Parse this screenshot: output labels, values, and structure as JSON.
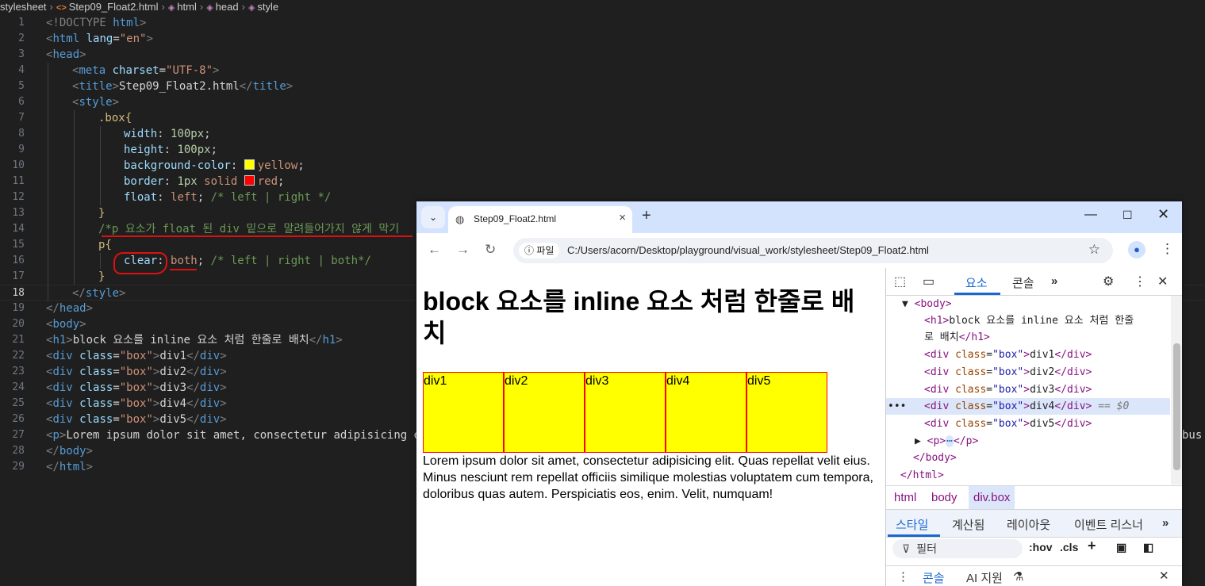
{
  "editor": {
    "breadcrumbs": [
      "stylesheet",
      "Step09_Float2.html",
      "html",
      "head",
      "style"
    ],
    "lines": [
      {
        "n": "1"
      },
      {
        "n": "2"
      },
      {
        "n": "3"
      },
      {
        "n": "4"
      },
      {
        "n": "5"
      },
      {
        "n": "6"
      },
      {
        "n": "7"
      },
      {
        "n": "8"
      },
      {
        "n": "9"
      },
      {
        "n": "10"
      },
      {
        "n": "11"
      },
      {
        "n": "12"
      },
      {
        "n": "13"
      },
      {
        "n": "14"
      },
      {
        "n": "15"
      },
      {
        "n": "16"
      },
      {
        "n": "17"
      },
      {
        "n": "18"
      },
      {
        "n": "19"
      },
      {
        "n": "20"
      },
      {
        "n": "21"
      },
      {
        "n": "22"
      },
      {
        "n": "23"
      },
      {
        "n": "24"
      },
      {
        "n": "25"
      },
      {
        "n": "26"
      },
      {
        "n": "27"
      },
      {
        "n": "28"
      },
      {
        "n": "29"
      }
    ],
    "tokens": {
      "doctype": "<!DOCTYPE",
      "html_kw": " html",
      "html": "html",
      "lang": " lang",
      "lang_val": "\"en\"",
      "head": "head",
      "meta": "meta",
      "charset": " charset",
      "charset_val": "\"UTF-8\"",
      "title": "title",
      "title_text": "Step09_Float2.html",
      "style": "style",
      "box_sel": ".box{",
      "width_prop": "width",
      "width_val": "100px",
      "height_prop": "height",
      "height_val": "100px",
      "bg_prop": "background-color",
      "bg_val": "yellow",
      "border_prop": "border",
      "border_num": "1px",
      "border_style": " solid ",
      "border_color": "red",
      "float_prop": "float",
      "float_val": "left",
      "float_comment": "/* left | right */",
      "close_brace": "}",
      "p_comment": "/*p 요소가 float 된 div 밑으로 말려들어가지 않게 막기",
      "p_sel": "p{",
      "clear_prop": "clear",
      "clear_val": "both",
      "clear_comment": "/* left | right | both*/",
      "body": "body",
      "h1": "h1",
      "h1_text": "block 요소를 inline 요소 처럼 한줄로 배치",
      "div": "div",
      "class": " class",
      "class_val": "\"box\"",
      "div1": "div1",
      "div2": "div2",
      "div3": "div3",
      "div4": "div4",
      "div5": "div5",
      "p": "p",
      "p_text": "Lorem ipsum dolor sit amet, consectetur adipisicing el",
      "p_tail": "bus"
    }
  },
  "browser": {
    "tab_title": "Step09_Float2.html",
    "info_chip": "파일",
    "url": "C:/Users/acorn/Desktop/playground/visual_work/stylesheet/Step09_Float2.html",
    "page": {
      "h1": "block 요소를 inline 요소 처럼 한줄로 배치",
      "boxes": [
        "div1",
        "div2",
        "div3",
        "div4",
        "div5"
      ],
      "paragraph": "Lorem ipsum dolor sit amet, consectetur adipisicing elit. Quas repellat velit eius. Minus nesciunt rem repellat officiis similique molestias voluptatem cum tempora, doloribus quas autem. Perspiciatis eos, enim. Velit, numquam!"
    }
  },
  "devtools": {
    "tabs": [
      "요소",
      "콘솔"
    ],
    "tree": {
      "body_open": "<body>",
      "h1_open": "<h1>",
      "h1_text_1": "block 요소를 inline 요소 처럼 한줄",
      "h1_text_2": "로 배치",
      "h1_close": "</h1>",
      "div_open": "<div",
      "class_attr": " class",
      "class_val": "\"box\"",
      "gt": ">",
      "div_close": "</div>",
      "div_texts": [
        "div1",
        "div2",
        "div3",
        "div4",
        "div5"
      ],
      "selected_marker": "== $0",
      "p_open": "<p>",
      "ellipsis": "⋯",
      "p_close": "</p>",
      "body_close": "</body>",
      "html_close": "</html>"
    },
    "breadcrumbs": [
      "html",
      "body",
      "div.box"
    ],
    "style_tabs": [
      "스타일",
      "계산됨",
      "레이아웃",
      "이벤트 리스너"
    ],
    "filter_placeholder": "필터",
    "hov": ":hov",
    "cls": ".cls",
    "drawer": [
      "콘솔",
      "AI 지원"
    ]
  },
  "colors": {
    "editor_bg": "#1f1f1f",
    "accent_blue": "#1a67d2",
    "box_fill": "#ffff00",
    "box_border": "#ff0000",
    "annotation_red": "#e01010"
  },
  "icons": [
    "code-icon",
    "globe-icon",
    "close-icon",
    "star-icon",
    "profile-icon",
    "gear-icon",
    "inspect-icon",
    "device-icon",
    "filter-icon",
    "paint-icon",
    "sidebar-icon"
  ]
}
